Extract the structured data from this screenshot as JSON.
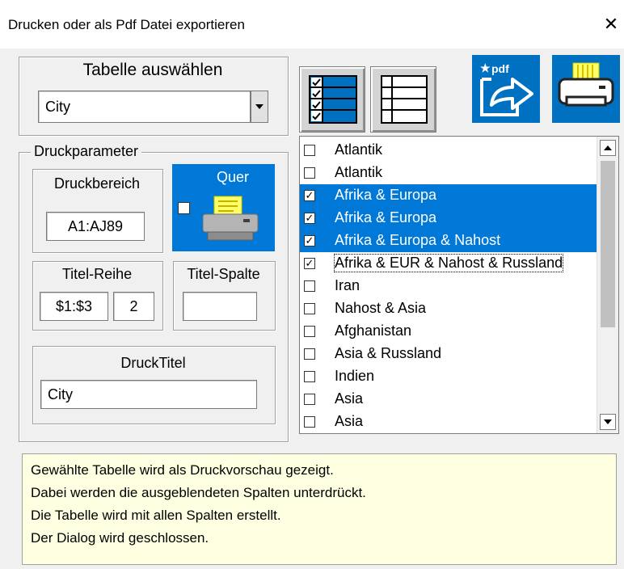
{
  "window": {
    "title": "Drucken oder als Pdf Datei exportieren",
    "close_glyph": "✕"
  },
  "table_select": {
    "label": "Tabelle auswählen",
    "selected": "City"
  },
  "print_params": {
    "group_label": "Druckparameter",
    "print_area_label": "Druckbereich",
    "print_area_value": "A1:AJ89",
    "landscape_label": "Quer",
    "landscape_checked": false,
    "title_row_label": "Titel-Reihe",
    "title_row_value": "$1:$3",
    "title_row_count": "2",
    "title_col_label": "Titel-Spalte",
    "title_col_value": "",
    "print_title_label": "DruckTitel",
    "print_title_value": "City"
  },
  "toolbar": {
    "select_all_icon": "checklist-icon",
    "deselect_all_icon": "table-icon",
    "pdf_export_icon": "pdf-export-icon",
    "pdf_text": "pdf",
    "print_icon": "printer-icon"
  },
  "list_items": [
    {
      "label": "Atlantik",
      "checked": false,
      "selected": false
    },
    {
      "label": "Atlantik",
      "checked": false,
      "selected": false
    },
    {
      "label": "Afrika & Europa",
      "checked": true,
      "selected": true
    },
    {
      "label": "Afrika & Europa",
      "checked": true,
      "selected": true
    },
    {
      "label": "Afrika & Europa & Nahost",
      "checked": true,
      "selected": true
    },
    {
      "label": "Afrika & EUR & Nahost & Russland",
      "checked": true,
      "selected": false,
      "focused": true
    },
    {
      "label": "Iran",
      "checked": false,
      "selected": false
    },
    {
      "label": "Nahost & Asia",
      "checked": false,
      "selected": false
    },
    {
      "label": "Afghanistan",
      "checked": false,
      "selected": false
    },
    {
      "label": "Asia & Russland",
      "checked": false,
      "selected": false
    },
    {
      "label": "Indien",
      "checked": false,
      "selected": false
    },
    {
      "label": "Asia",
      "checked": false,
      "selected": false
    },
    {
      "label": "Asia",
      "checked": false,
      "selected": false
    }
  ],
  "info": {
    "lines": [
      "Gewählte Tabelle wird als Druckvorschau gezeigt.",
      "Dabei werden die ausgeblendeten Spalten unterdrückt.",
      "Die Tabelle wird mit allen Spalten erstellt.",
      "Der Dialog wird geschlossen."
    ]
  },
  "colors": {
    "selection": "#0078d7",
    "icon_blue": "#0070c0",
    "info_bg": "#ffffe1",
    "dialog_bg": "#f0f0f0"
  }
}
